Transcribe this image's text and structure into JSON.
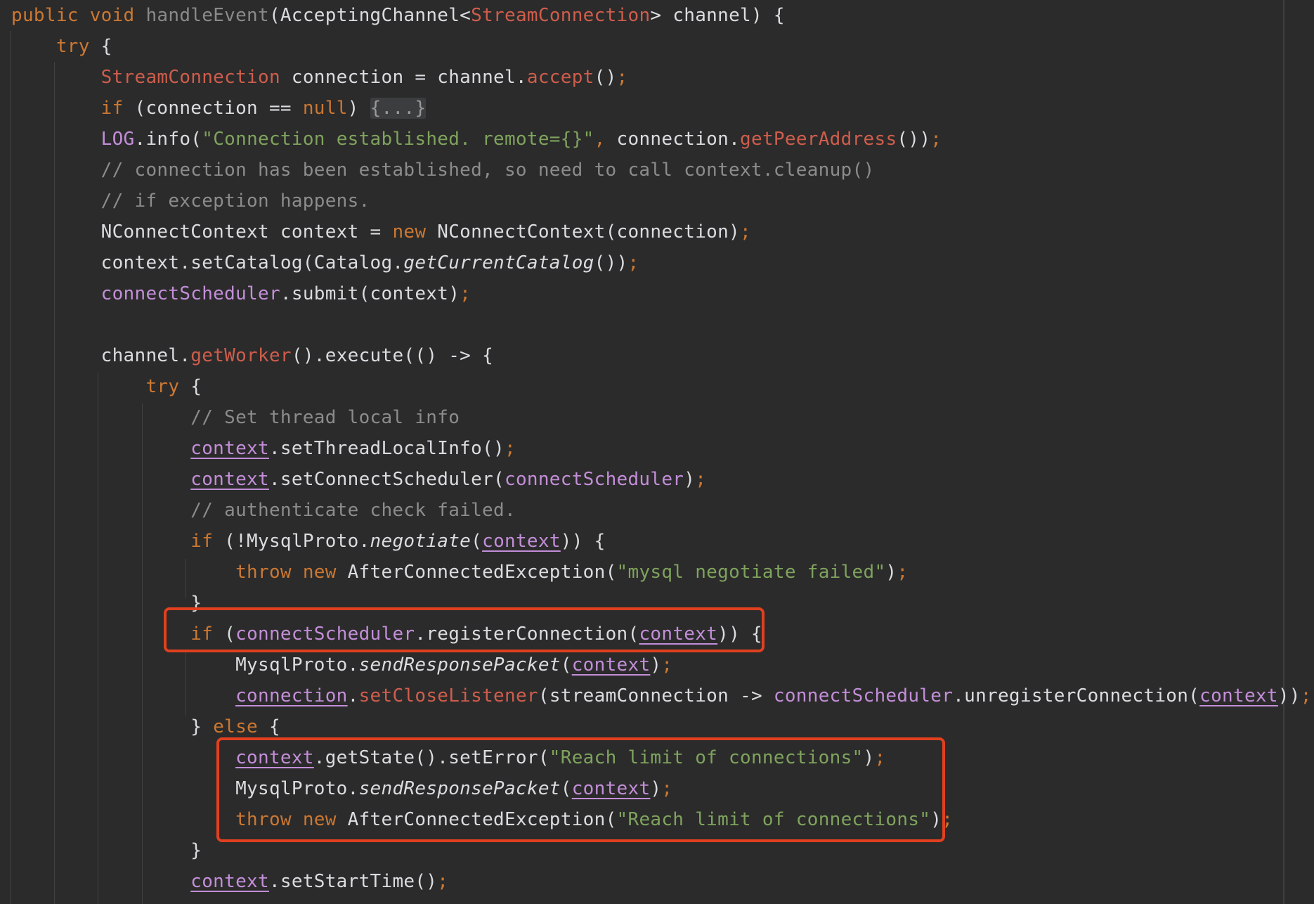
{
  "code": {
    "lines": [
      [
        {
          "t": "public ",
          "c": "kw"
        },
        {
          "t": "void ",
          "c": "kw"
        },
        {
          "t": "handleEvent",
          "c": "dim"
        },
        {
          "t": "(AcceptingChannel<",
          "c": "plain"
        },
        {
          "t": "StreamConnection",
          "c": "type"
        },
        {
          "t": "> channel) {",
          "c": "plain"
        }
      ],
      [
        {
          "t": "    ",
          "c": "plain"
        },
        {
          "t": "try",
          "c": "kw"
        },
        {
          "t": " {",
          "c": "plain"
        }
      ],
      [
        {
          "t": "        ",
          "c": "plain"
        },
        {
          "t": "StreamConnection",
          "c": "type"
        },
        {
          "t": " connection = channel.",
          "c": "plain"
        },
        {
          "t": "accept",
          "c": "method"
        },
        {
          "t": "()",
          "c": "plain"
        },
        {
          "t": ";",
          "c": "punct"
        }
      ],
      [
        {
          "t": "        ",
          "c": "plain"
        },
        {
          "t": "if",
          "c": "kw"
        },
        {
          "t": " (connection == ",
          "c": "plain"
        },
        {
          "t": "null",
          "c": "kw"
        },
        {
          "t": ") ",
          "c": "plain"
        },
        {
          "t": "{...}",
          "c": "fold"
        }
      ],
      [
        {
          "t": "        ",
          "c": "plain"
        },
        {
          "t": "LOG",
          "c": "field"
        },
        {
          "t": ".info(",
          "c": "plain"
        },
        {
          "t": "\"Connection established. remote={}\"",
          "c": "string"
        },
        {
          "t": ", ",
          "c": "punct"
        },
        {
          "t": "connection.",
          "c": "plain"
        },
        {
          "t": "getPeerAddress",
          "c": "method"
        },
        {
          "t": "())",
          "c": "plain"
        },
        {
          "t": ";",
          "c": "punct"
        }
      ],
      [
        {
          "t": "        ",
          "c": "plain"
        },
        {
          "t": "// connection has been established, so need to call context.cleanup()",
          "c": "comment"
        }
      ],
      [
        {
          "t": "        ",
          "c": "plain"
        },
        {
          "t": "// if exception happens.",
          "c": "comment"
        }
      ],
      [
        {
          "t": "        ",
          "c": "plain"
        },
        {
          "t": "NConnectContext context = ",
          "c": "plain"
        },
        {
          "t": "new ",
          "c": "kw"
        },
        {
          "t": "NConnectContext(connection)",
          "c": "plain"
        },
        {
          "t": ";",
          "c": "punct"
        }
      ],
      [
        {
          "t": "        ",
          "c": "plain"
        },
        {
          "t": "context.setCatalog(Catalog.",
          "c": "plain"
        },
        {
          "t": "getCurrentCatalog",
          "c": "italic"
        },
        {
          "t": "())",
          "c": "plain"
        },
        {
          "t": ";",
          "c": "punct"
        }
      ],
      [
        {
          "t": "        ",
          "c": "plain"
        },
        {
          "t": "connectScheduler",
          "c": "field"
        },
        {
          "t": ".submit(context)",
          "c": "plain"
        },
        {
          "t": ";",
          "c": "punct"
        }
      ],
      [],
      [
        {
          "t": "        ",
          "c": "plain"
        },
        {
          "t": "channel.",
          "c": "plain"
        },
        {
          "t": "getWorker",
          "c": "method"
        },
        {
          "t": "().execute(() -> {",
          "c": "plain"
        }
      ],
      [
        {
          "t": "            ",
          "c": "plain"
        },
        {
          "t": "try",
          "c": "kw"
        },
        {
          "t": " {",
          "c": "plain"
        }
      ],
      [
        {
          "t": "                ",
          "c": "plain"
        },
        {
          "t": "// Set thread local info",
          "c": "comment"
        }
      ],
      [
        {
          "t": "                ",
          "c": "plain"
        },
        {
          "t": "context",
          "c": "ulvar"
        },
        {
          "t": ".setThreadLocalInfo()",
          "c": "plain"
        },
        {
          "t": ";",
          "c": "punct"
        }
      ],
      [
        {
          "t": "                ",
          "c": "plain"
        },
        {
          "t": "context",
          "c": "ulvar"
        },
        {
          "t": ".setConnectScheduler(",
          "c": "plain"
        },
        {
          "t": "connectScheduler",
          "c": "field"
        },
        {
          "t": ")",
          "c": "plain"
        },
        {
          "t": ";",
          "c": "punct"
        }
      ],
      [
        {
          "t": "                ",
          "c": "plain"
        },
        {
          "t": "// authenticate check failed.",
          "c": "comment"
        }
      ],
      [
        {
          "t": "                ",
          "c": "plain"
        },
        {
          "t": "if",
          "c": "kw"
        },
        {
          "t": " (!MysqlProto.",
          "c": "plain"
        },
        {
          "t": "negotiate",
          "c": "italic"
        },
        {
          "t": "(",
          "c": "plain"
        },
        {
          "t": "context",
          "c": "ulvar"
        },
        {
          "t": ")) {",
          "c": "plain"
        }
      ],
      [
        {
          "t": "                    ",
          "c": "plain"
        },
        {
          "t": "throw ",
          "c": "kw"
        },
        {
          "t": "new ",
          "c": "kw"
        },
        {
          "t": "AfterConnectedException(",
          "c": "plain"
        },
        {
          "t": "\"mysql negotiate failed\"",
          "c": "string"
        },
        {
          "t": ")",
          "c": "plain"
        },
        {
          "t": ";",
          "c": "punct"
        }
      ],
      [
        {
          "t": "                ",
          "c": "plain"
        },
        {
          "t": "}",
          "c": "plain"
        }
      ],
      [
        {
          "t": "                ",
          "c": "plain"
        },
        {
          "t": "if",
          "c": "kw"
        },
        {
          "t": " (",
          "c": "plain"
        },
        {
          "t": "connectScheduler",
          "c": "field"
        },
        {
          "t": ".registerConnection(",
          "c": "plain"
        },
        {
          "t": "context",
          "c": "ulvar"
        },
        {
          "t": ")) {",
          "c": "plain"
        }
      ],
      [
        {
          "t": "                    ",
          "c": "plain"
        },
        {
          "t": "MysqlProto.",
          "c": "plain"
        },
        {
          "t": "sendResponsePacket",
          "c": "italic"
        },
        {
          "t": "(",
          "c": "plain"
        },
        {
          "t": "context",
          "c": "ulvar"
        },
        {
          "t": ")",
          "c": "plain"
        },
        {
          "t": ";",
          "c": "punct"
        }
      ],
      [
        {
          "t": "                    ",
          "c": "plain"
        },
        {
          "t": "connection",
          "c": "ulvar"
        },
        {
          "t": ".",
          "c": "plain"
        },
        {
          "t": "setCloseListener",
          "c": "method"
        },
        {
          "t": "(streamConnection -> ",
          "c": "plain"
        },
        {
          "t": "connectScheduler",
          "c": "field"
        },
        {
          "t": ".unregisterConnection(",
          "c": "plain"
        },
        {
          "t": "context",
          "c": "ulvar"
        },
        {
          "t": "))",
          "c": "plain"
        },
        {
          "t": ";",
          "c": "punct"
        }
      ],
      [
        {
          "t": "                ",
          "c": "plain"
        },
        {
          "t": "} ",
          "c": "plain"
        },
        {
          "t": "else",
          "c": "kw"
        },
        {
          "t": " {",
          "c": "plain"
        }
      ],
      [
        {
          "t": "                    ",
          "c": "plain"
        },
        {
          "t": "context",
          "c": "ulvar"
        },
        {
          "t": ".getState().setError(",
          "c": "plain"
        },
        {
          "t": "\"Reach limit of connections\"",
          "c": "string"
        },
        {
          "t": ")",
          "c": "plain"
        },
        {
          "t": ";",
          "c": "punct"
        }
      ],
      [
        {
          "t": "                    ",
          "c": "plain"
        },
        {
          "t": "MysqlProto.",
          "c": "plain"
        },
        {
          "t": "sendResponsePacket",
          "c": "italic"
        },
        {
          "t": "(",
          "c": "plain"
        },
        {
          "t": "context",
          "c": "ulvar"
        },
        {
          "t": ")",
          "c": "plain"
        },
        {
          "t": ";",
          "c": "punct"
        }
      ],
      [
        {
          "t": "                    ",
          "c": "plain"
        },
        {
          "t": "throw ",
          "c": "kw"
        },
        {
          "t": "new ",
          "c": "kw"
        },
        {
          "t": "AfterConnectedException(",
          "c": "plain"
        },
        {
          "t": "\"Reach limit of connections\"",
          "c": "string"
        },
        {
          "t": ")",
          "c": "plain"
        },
        {
          "t": ";",
          "c": "punct"
        }
      ],
      [
        {
          "t": "                ",
          "c": "plain"
        },
        {
          "t": "}",
          "c": "plain"
        }
      ],
      [
        {
          "t": "                ",
          "c": "plain"
        },
        {
          "t": "context",
          "c": "ulvar"
        },
        {
          "t": ".setStartTime()",
          "c": "plain"
        },
        {
          "t": ";",
          "c": "punct"
        }
      ]
    ]
  },
  "colors": {
    "background": "#2b2b2b",
    "highlight_box": "#e0401f"
  }
}
